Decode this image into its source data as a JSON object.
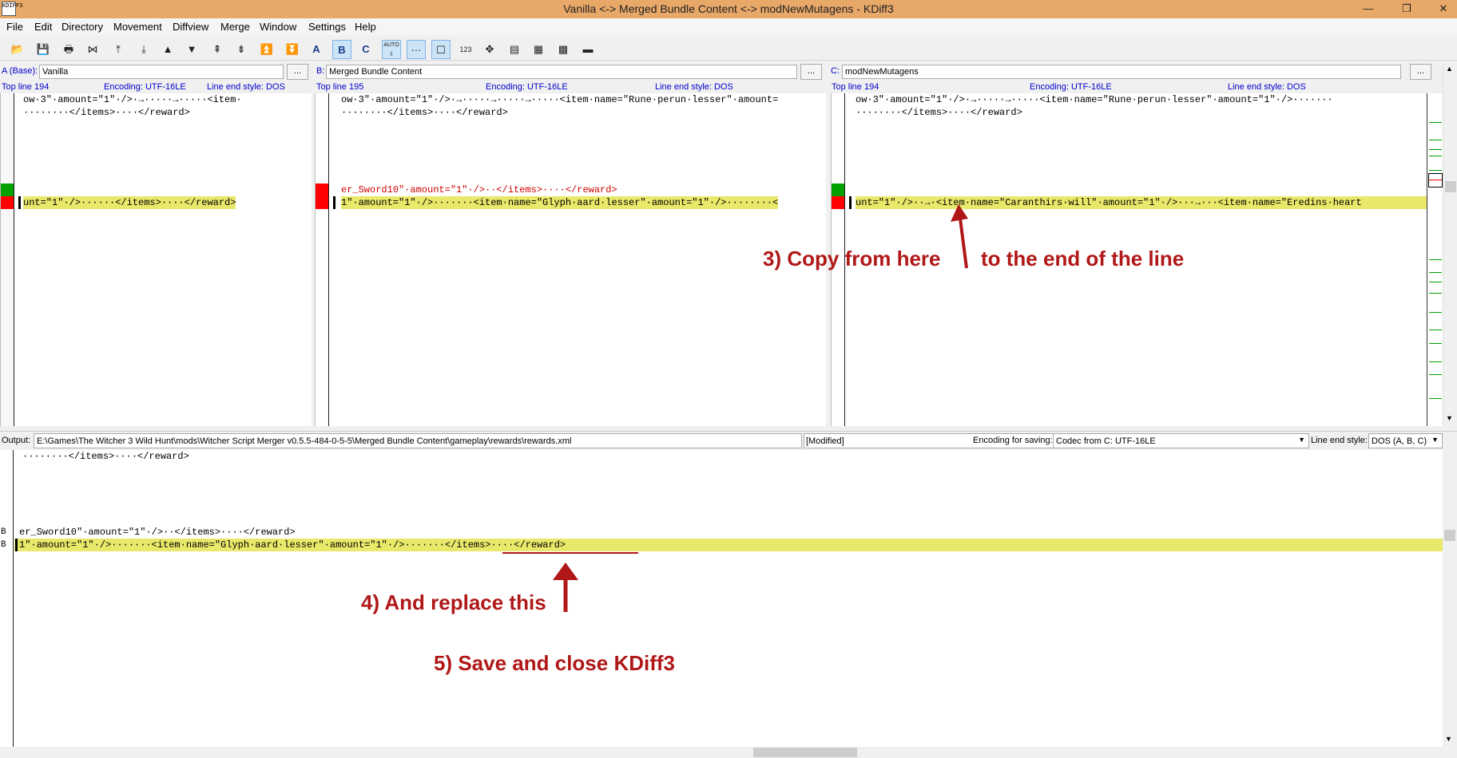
{
  "window": {
    "title": "Vanilla <-> Merged Bundle Content <-> modNewMutagens - KDiff3",
    "app_icon_text": "KDIFF3"
  },
  "menu": [
    "File",
    "Edit",
    "Directory",
    "Movement",
    "Diffview",
    "Merge",
    "Window",
    "Settings",
    "Help"
  ],
  "toolbar": {
    "a_label": "A",
    "b_label": "B",
    "c_label": "C",
    "auto_label": "AUTO",
    "num_label": "123"
  },
  "panes": {
    "a": {
      "label": "A (Base):",
      "file": "Vanilla",
      "top_line": "Top line 194",
      "encoding": "Encoding: UTF-16LE",
      "line_end": "Line end style: DOS",
      "lines": [
        "ow·3\"·amount=\"1\"·/>·→·····→·····<item·",
        "········</items>····</reward>",
        "unt=\"1\"·/>······</items>····</reward>"
      ]
    },
    "b": {
      "label": "B:",
      "file": "Merged Bundle Content",
      "top_line": "Top line 195",
      "encoding": "Encoding: UTF-16LE",
      "line_end": "Line end style: DOS",
      "lines": [
        "ow·3\"·amount=\"1\"·/>·→·····→·····→·····<item·name=\"Rune·perun·lesser\"·amount=",
        "········</items>····</reward>",
        "er_Sword10\"·amount=\"1\"·/>··</items>····</reward>",
        "1\"·amount=\"1\"·/>·······<item·name=\"Glyph·aard·lesser\"·amount=\"1\"·/>········<"
      ]
    },
    "c": {
      "label": "C:",
      "file": "modNewMutagens",
      "top_line": "Top line 194",
      "encoding": "Encoding: UTF-16LE",
      "line_end": "Line end style: DOS",
      "lines": [
        "ow·3\"·amount=\"1\"·/>·→·····→·····<item·name=\"Rune·perun·lesser\"·amount=\"1\"·/>·······",
        "········</items>····</reward>",
        "unt=\"1\"·/>··→·<item·name=\"Caranthirs·will\"·amount=\"1\"·/>···→···<item·name=\"Eredins·heart"
      ]
    },
    "dots": "..."
  },
  "output": {
    "label": "Output:",
    "path": "E:\\Games\\The Witcher 3 Wild Hunt\\mods\\Witcher Script Merger v0.5.5-484-0-5-5\\Merged Bundle Content\\gameplay\\rewards\\rewards.xml",
    "status": "[Modified]",
    "encoding_label": "Encoding for saving:",
    "encoding_value": "Codec from C: UTF-16LE",
    "line_end_label": "Line end style:",
    "line_end_value": "DOS (A, B, C)",
    "lines": [
      "········</items>····</reward>",
      "er_Sword10\"·amount=\"1\"·/>··</items>····</reward>",
      "1\"·amount=\"1\"·/>·······<item·name=\"Glyph·aard·lesser\"·amount=\"1\"·/>·······</items>····</reward>"
    ],
    "source_markers": [
      "B",
      "B"
    ]
  },
  "annotations": {
    "step3_left": "3) Copy from here",
    "step3_right": "to the end of the line",
    "step4": "4) And replace this",
    "step5": "5) Save and close KDiff3"
  },
  "colors": {
    "titlebar": "#e8a868",
    "diff_highlight": "#e8e86a",
    "annotation": "#b01818",
    "marker_green": "#00a000",
    "marker_red": "#ff0000"
  }
}
